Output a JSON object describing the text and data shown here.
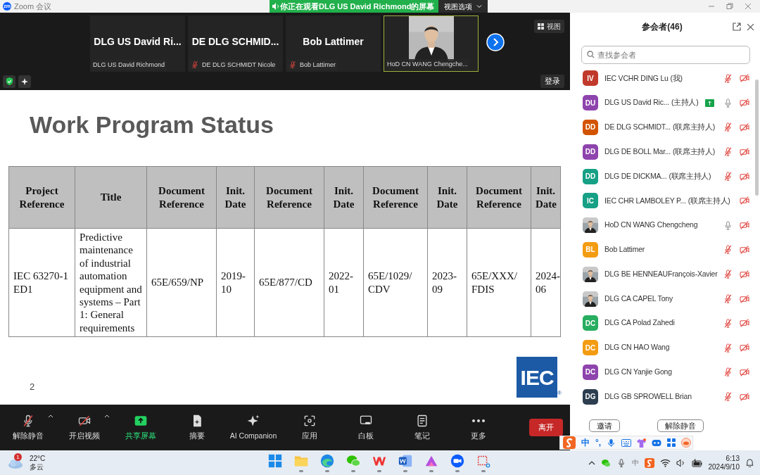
{
  "window": {
    "logo": "zm",
    "title": "Zoom 会议",
    "banner": "你正在观看DLG US David Richmond的屏幕",
    "view_options": "视图选项"
  },
  "video_strip": {
    "tiles": [
      {
        "kind": "name",
        "name": "DLG US David Ri...",
        "label": "DLG US David Richmond",
        "muted": false,
        "speaking": false
      },
      {
        "kind": "name",
        "name": "DE DLG SCHMID...",
        "label": "DE DLG SCHMIDT Nicole",
        "muted": true,
        "speaking": false
      },
      {
        "kind": "name",
        "name": "Bob Lattimer",
        "label": "Bob Lattimer",
        "muted": true,
        "speaking": false
      },
      {
        "kind": "video",
        "label": "HoD CN WANG Chengche...",
        "muted": false,
        "speaking": true
      }
    ],
    "view_button": "视图",
    "login_button": "登录"
  },
  "slide": {
    "title": "Work Program Status",
    "table": {
      "columns": [
        "Project Reference",
        "Title",
        "Document Reference",
        "Init. Date",
        "Document Reference",
        "Init. Date",
        "Document Reference",
        "Init. Date",
        "Document Reference",
        "Init. Date"
      ],
      "rows": [
        [
          "IEC 63270-1 ED1",
          "Predictive maintenance of industrial automation equipment and systems – Part 1: General requirements",
          "65E/659/NP",
          "2019-10",
          "65E/877/CD",
          "2022-01",
          "65E/1029/CDV",
          "2023-09",
          "65E/XXX/FDIS",
          "2024-06"
        ]
      ]
    },
    "page_number": "2",
    "logo": {
      "text": "IEC",
      "mark": "®"
    }
  },
  "toolbar": {
    "items": [
      {
        "kind": "mic-off",
        "label": "解除静音",
        "caret": true,
        "highlighted": false
      },
      {
        "kind": "video-off",
        "label": "开启视频",
        "caret": true,
        "highlighted": false
      },
      {
        "kind": "share",
        "label": "共享屏幕",
        "caret": false,
        "highlighted": true
      },
      {
        "kind": "summary",
        "label": "摘要",
        "caret": false,
        "highlighted": false
      },
      {
        "kind": "ai",
        "label": "AI Companion",
        "caret": false,
        "highlighted": false
      },
      {
        "kind": "apps",
        "label": "应用",
        "caret": false,
        "highlighted": false
      },
      {
        "kind": "whiteboard",
        "label": "白板",
        "caret": false,
        "highlighted": false
      },
      {
        "kind": "notes",
        "label": "笔记",
        "caret": false,
        "highlighted": false
      },
      {
        "kind": "more",
        "label": "更多",
        "caret": false,
        "highlighted": false
      }
    ],
    "leave_button": "离开"
  },
  "participants": {
    "title": "参会者(46)",
    "search": {
      "placeholder": "查找参会者"
    },
    "rows": [
      {
        "kind": "initials",
        "initials": "IV",
        "color": "#c0392b",
        "name": "IEC VCHR DING Lu (我)",
        "audio": true,
        "muted": true,
        "sharing": false
      },
      {
        "kind": "initials",
        "initials": "DU",
        "color": "#8e44ad",
        "name": "DLG US David Ric...",
        "role": "(主持人)",
        "audio": true,
        "muted": false,
        "sharing": true
      },
      {
        "kind": "initials",
        "initials": "DD",
        "color": "#d35400",
        "name": "DE DLG SCHMIDT...",
        "role": "(联席主持人)",
        "audio": true,
        "muted": true,
        "sharing": false
      },
      {
        "kind": "initials",
        "initials": "DD",
        "color": "#8e44ad",
        "name": "DLG DE BOLL Mar...",
        "role": "(联席主持人)",
        "audio": true,
        "muted": true,
        "sharing": false
      },
      {
        "kind": "initials",
        "initials": "DD",
        "color": "#16a085",
        "name": "DLG DE DICKMA...",
        "role": "(联席主持人)",
        "audio": true,
        "muted": true,
        "sharing": false
      },
      {
        "kind": "initials",
        "initials": "IC",
        "color": "#16a085",
        "name": "IEC CHR LAMBOLEY P...",
        "role": "(联席主持人)",
        "audio": false,
        "sharing": false
      },
      {
        "name": "HoD CN WANG Chengcheng",
        "audio": true,
        "muted": false,
        "sharing": false
      },
      {
        "kind": "initials",
        "initials": "BL",
        "color": "#f39c12",
        "name": "Bob Lattimer",
        "audio": true,
        "muted": true,
        "sharing": false
      },
      {
        "name": "DLG BE HENNEAUFrançois-Xavier",
        "audio": true,
        "muted": true,
        "sharing": false
      },
      {
        "name": "DLG CA CAPEL Tony",
        "audio": true,
        "muted": true,
        "sharing": false
      },
      {
        "kind": "initials",
        "initials": "DC",
        "color": "#27ae60",
        "name": "DLG CA Polad Zahedi",
        "audio": true,
        "muted": true,
        "sharing": false
      },
      {
        "kind": "initials",
        "initials": "DC",
        "color": "#f39c12",
        "name": "DLG CN HAO Wang",
        "audio": true,
        "muted": true,
        "sharing": false
      },
      {
        "kind": "initials",
        "initials": "DC",
        "color": "#8e44ad",
        "name": "DLG CN Yanjie Gong",
        "audio": true,
        "muted": true,
        "sharing": false
      },
      {
        "kind": "initials",
        "initials": "DG",
        "color": "#2c3e50",
        "name": "DLG GB SPROWELL Brian",
        "audio": true,
        "muted": true,
        "sharing": false
      }
    ],
    "buttons": [
      "邀请",
      "解除静音"
    ]
  },
  "ime_bar": {
    "mode": "中",
    "punctuation": "°,"
  },
  "taskbar": {
    "weather": {
      "badge": "1",
      "temperature": "22°C",
      "condition": "多云"
    },
    "tray_ime": "中",
    "time": "6:13",
    "date": "2024/9/10"
  }
}
